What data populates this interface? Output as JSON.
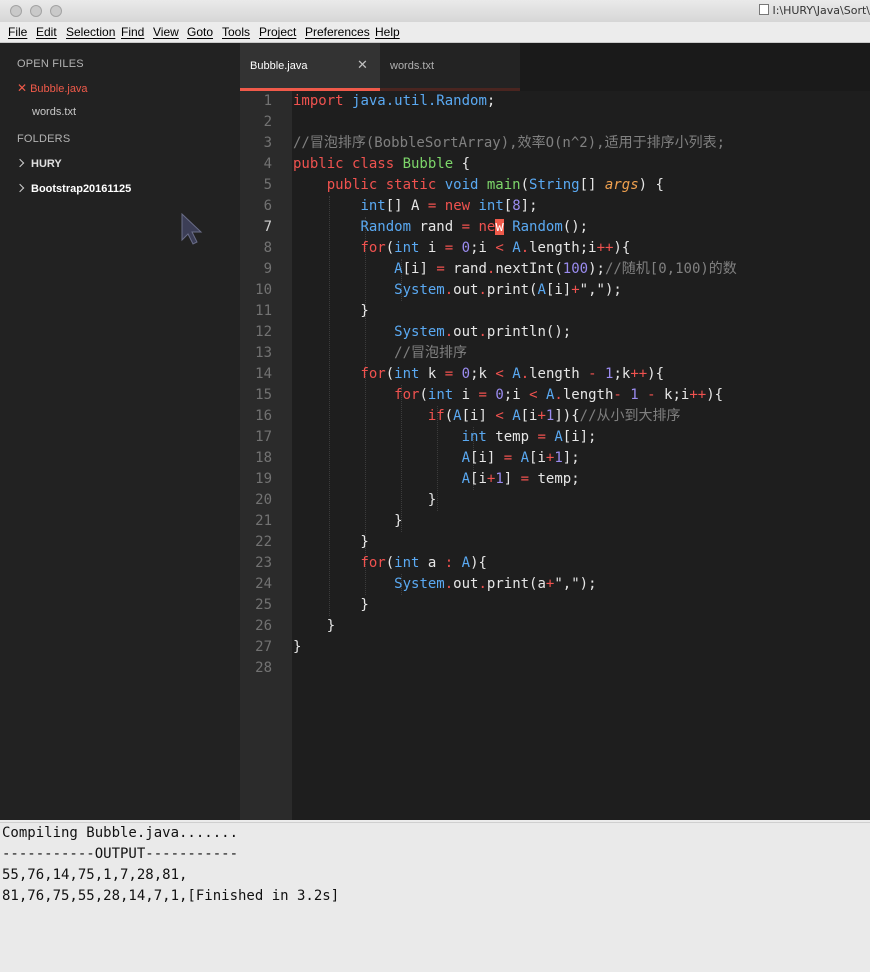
{
  "window": {
    "path": "I:\\HURY\\Java\\Sort\\"
  },
  "menu": [
    "File",
    "Edit",
    "Selection",
    "Find",
    "View",
    "Goto",
    "Tools",
    "Project",
    "Preferences",
    "Help"
  ],
  "sidebar": {
    "open_files_label": "OPEN FILES",
    "open_files": [
      "Bubble.java",
      "words.txt"
    ],
    "folders_label": "FOLDERS",
    "folders": [
      "HURY",
      "Bootstrap20161125"
    ]
  },
  "tabs": [
    "Bubble.java",
    "words.txt"
  ],
  "line_numbers": [
    "1",
    "2",
    "3",
    "4",
    "5",
    "6",
    "7",
    "8",
    "9",
    "10",
    "11",
    "12",
    "13",
    "14",
    "15",
    "16",
    "17",
    "18",
    "19",
    "20",
    "21",
    "22",
    "23",
    "24",
    "25",
    "26",
    "27",
    "28"
  ],
  "code": [
    {
      "t": [
        {
          "s": "import ",
          "c": "kw"
        },
        {
          "s": "java.util.Random",
          "c": "ty"
        },
        {
          "s": ";",
          "c": ""
        }
      ]
    },
    {
      "t": []
    },
    {
      "t": [
        {
          "s": "//冒泡排序(BobbleSortArray),效率O(n^2),适用于排序小列表;",
          "c": "cm"
        }
      ]
    },
    {
      "t": [
        {
          "s": "public class ",
          "c": "kw"
        },
        {
          "s": "Bubble",
          "c": "fn"
        },
        {
          "s": " {",
          "c": ""
        }
      ]
    },
    {
      "t": [
        {
          "s": "    public static ",
          "c": "kw"
        },
        {
          "s": "void ",
          "c": "ty"
        },
        {
          "s": "main",
          "c": "fn"
        },
        {
          "s": "(",
          "c": ""
        },
        {
          "s": "String",
          "c": "ty"
        },
        {
          "s": "[] ",
          "c": ""
        },
        {
          "s": "args",
          "c": "pr"
        },
        {
          "s": ") {",
          "c": ""
        }
      ]
    },
    {
      "t": [
        {
          "s": "        ",
          "c": ""
        },
        {
          "s": "int",
          "c": "ty"
        },
        {
          "s": "[] A ",
          "c": ""
        },
        {
          "s": "=",
          "c": "kw"
        },
        {
          "s": " ",
          "c": ""
        },
        {
          "s": "new ",
          "c": "kw"
        },
        {
          "s": "int",
          "c": "ty"
        },
        {
          "s": "[",
          "c": ""
        },
        {
          "s": "8",
          "c": "num"
        },
        {
          "s": "];",
          "c": ""
        }
      ]
    },
    {
      "t": [
        {
          "s": "        ",
          "c": ""
        },
        {
          "s": "Random",
          "c": "ty"
        },
        {
          "s": " rand ",
          "c": ""
        },
        {
          "s": "=",
          "c": "kw"
        },
        {
          "s": " ",
          "c": ""
        },
        {
          "s": "ne",
          "c": "kw"
        },
        {
          "s": "w",
          "c": "cursor"
        },
        {
          "s": " ",
          "c": ""
        },
        {
          "s": "Random",
          "c": "ty"
        },
        {
          "s": "();",
          "c": ""
        }
      ]
    },
    {
      "t": [
        {
          "s": "        ",
          "c": ""
        },
        {
          "s": "for",
          "c": "kw"
        },
        {
          "s": "(",
          "c": ""
        },
        {
          "s": "int",
          "c": "ty"
        },
        {
          "s": " i ",
          "c": ""
        },
        {
          "s": "=",
          "c": "kw"
        },
        {
          "s": " ",
          "c": ""
        },
        {
          "s": "0",
          "c": "num"
        },
        {
          "s": ";i ",
          "c": ""
        },
        {
          "s": "<",
          "c": "kw"
        },
        {
          "s": " ",
          "c": ""
        },
        {
          "s": "A",
          "c": "ty"
        },
        {
          "s": ".",
          "c": "kw"
        },
        {
          "s": "length;i",
          "c": ""
        },
        {
          "s": "++",
          "c": "kw"
        },
        {
          "s": "){",
          "c": ""
        }
      ]
    },
    {
      "t": [
        {
          "s": "            ",
          "c": ""
        },
        {
          "s": "A",
          "c": "ty"
        },
        {
          "s": "[i] ",
          "c": ""
        },
        {
          "s": "=",
          "c": "kw"
        },
        {
          "s": " rand",
          "c": ""
        },
        {
          "s": ".",
          "c": "kw"
        },
        {
          "s": "nextInt(",
          "c": ""
        },
        {
          "s": "100",
          "c": "num"
        },
        {
          "s": ");",
          "c": ""
        },
        {
          "s": "//随机[0,100)的数",
          "c": "cm"
        }
      ]
    },
    {
      "t": [
        {
          "s": "            ",
          "c": ""
        },
        {
          "s": "System",
          "c": "ty"
        },
        {
          "s": ".",
          "c": "kw"
        },
        {
          "s": "out",
          "c": ""
        },
        {
          "s": ".",
          "c": "kw"
        },
        {
          "s": "print(",
          "c": ""
        },
        {
          "s": "A",
          "c": "ty"
        },
        {
          "s": "[i]",
          "c": ""
        },
        {
          "s": "+",
          "c": "kw"
        },
        {
          "s": "\",\"",
          "c": "str"
        },
        {
          "s": ");",
          "c": ""
        }
      ]
    },
    {
      "t": [
        {
          "s": "        }",
          "c": ""
        }
      ]
    },
    {
      "t": [
        {
          "s": "            ",
          "c": ""
        },
        {
          "s": "System",
          "c": "ty"
        },
        {
          "s": ".",
          "c": "kw"
        },
        {
          "s": "out",
          "c": ""
        },
        {
          "s": ".",
          "c": "kw"
        },
        {
          "s": "println();",
          "c": ""
        }
      ]
    },
    {
      "t": [
        {
          "s": "            ",
          "c": ""
        },
        {
          "s": "//冒泡排序",
          "c": "cm"
        }
      ]
    },
    {
      "t": [
        {
          "s": "        ",
          "c": ""
        },
        {
          "s": "for",
          "c": "kw"
        },
        {
          "s": "(",
          "c": ""
        },
        {
          "s": "int",
          "c": "ty"
        },
        {
          "s": " k ",
          "c": ""
        },
        {
          "s": "=",
          "c": "kw"
        },
        {
          "s": " ",
          "c": ""
        },
        {
          "s": "0",
          "c": "num"
        },
        {
          "s": ";k ",
          "c": ""
        },
        {
          "s": "<",
          "c": "kw"
        },
        {
          "s": " ",
          "c": ""
        },
        {
          "s": "A",
          "c": "ty"
        },
        {
          "s": ".",
          "c": "kw"
        },
        {
          "s": "length ",
          "c": ""
        },
        {
          "s": "-",
          "c": "kw"
        },
        {
          "s": " ",
          "c": ""
        },
        {
          "s": "1",
          "c": "num"
        },
        {
          "s": ";k",
          "c": ""
        },
        {
          "s": "++",
          "c": "kw"
        },
        {
          "s": "){",
          "c": ""
        }
      ]
    },
    {
      "t": [
        {
          "s": "            ",
          "c": ""
        },
        {
          "s": "for",
          "c": "kw"
        },
        {
          "s": "(",
          "c": ""
        },
        {
          "s": "int",
          "c": "ty"
        },
        {
          "s": " i ",
          "c": ""
        },
        {
          "s": "=",
          "c": "kw"
        },
        {
          "s": " ",
          "c": ""
        },
        {
          "s": "0",
          "c": "num"
        },
        {
          "s": ";i ",
          "c": ""
        },
        {
          "s": "<",
          "c": "kw"
        },
        {
          "s": " ",
          "c": ""
        },
        {
          "s": "A",
          "c": "ty"
        },
        {
          "s": ".",
          "c": "kw"
        },
        {
          "s": "length",
          "c": ""
        },
        {
          "s": "-",
          "c": "kw"
        },
        {
          "s": " ",
          "c": ""
        },
        {
          "s": "1",
          "c": "num"
        },
        {
          "s": " ",
          "c": ""
        },
        {
          "s": "-",
          "c": "kw"
        },
        {
          "s": " k;i",
          "c": ""
        },
        {
          "s": "++",
          "c": "kw"
        },
        {
          "s": "){",
          "c": ""
        }
      ]
    },
    {
      "t": [
        {
          "s": "                ",
          "c": ""
        },
        {
          "s": "if",
          "c": "kw"
        },
        {
          "s": "(",
          "c": ""
        },
        {
          "s": "A",
          "c": "ty"
        },
        {
          "s": "[i] ",
          "c": ""
        },
        {
          "s": "<",
          "c": "kw"
        },
        {
          "s": " ",
          "c": ""
        },
        {
          "s": "A",
          "c": "ty"
        },
        {
          "s": "[i",
          "c": ""
        },
        {
          "s": "+",
          "c": "kw"
        },
        {
          "s": "1",
          "c": "num"
        },
        {
          "s": "]){",
          "c": ""
        },
        {
          "s": "//从小到大排序",
          "c": "cm"
        }
      ]
    },
    {
      "t": [
        {
          "s": "                    ",
          "c": ""
        },
        {
          "s": "int",
          "c": "ty"
        },
        {
          "s": " temp ",
          "c": ""
        },
        {
          "s": "=",
          "c": "kw"
        },
        {
          "s": " ",
          "c": ""
        },
        {
          "s": "A",
          "c": "ty"
        },
        {
          "s": "[i];",
          "c": ""
        }
      ]
    },
    {
      "t": [
        {
          "s": "                    ",
          "c": ""
        },
        {
          "s": "A",
          "c": "ty"
        },
        {
          "s": "[i] ",
          "c": ""
        },
        {
          "s": "=",
          "c": "kw"
        },
        {
          "s": " ",
          "c": ""
        },
        {
          "s": "A",
          "c": "ty"
        },
        {
          "s": "[i",
          "c": ""
        },
        {
          "s": "+",
          "c": "kw"
        },
        {
          "s": "1",
          "c": "num"
        },
        {
          "s": "];",
          "c": ""
        }
      ]
    },
    {
      "t": [
        {
          "s": "                    ",
          "c": ""
        },
        {
          "s": "A",
          "c": "ty"
        },
        {
          "s": "[i",
          "c": ""
        },
        {
          "s": "+",
          "c": "kw"
        },
        {
          "s": "1",
          "c": "num"
        },
        {
          "s": "] ",
          "c": ""
        },
        {
          "s": "=",
          "c": "kw"
        },
        {
          "s": " temp;",
          "c": ""
        }
      ]
    },
    {
      "t": [
        {
          "s": "                }",
          "c": ""
        }
      ]
    },
    {
      "t": [
        {
          "s": "            }",
          "c": ""
        }
      ]
    },
    {
      "t": [
        {
          "s": "        }",
          "c": ""
        }
      ]
    },
    {
      "t": [
        {
          "s": "        ",
          "c": ""
        },
        {
          "s": "for",
          "c": "kw"
        },
        {
          "s": "(",
          "c": ""
        },
        {
          "s": "int",
          "c": "ty"
        },
        {
          "s": " a ",
          "c": ""
        },
        {
          "s": ":",
          "c": "kw"
        },
        {
          "s": " ",
          "c": ""
        },
        {
          "s": "A",
          "c": "ty"
        },
        {
          "s": "){",
          "c": ""
        }
      ]
    },
    {
      "t": [
        {
          "s": "            ",
          "c": ""
        },
        {
          "s": "System",
          "c": "ty"
        },
        {
          "s": ".",
          "c": "kw"
        },
        {
          "s": "out",
          "c": ""
        },
        {
          "s": ".",
          "c": "kw"
        },
        {
          "s": "print(a",
          "c": ""
        },
        {
          "s": "+",
          "c": "kw"
        },
        {
          "s": "\",\"",
          "c": "str"
        },
        {
          "s": ");",
          "c": ""
        }
      ]
    },
    {
      "t": [
        {
          "s": "        }",
          "c": ""
        }
      ]
    },
    {
      "t": [
        {
          "s": "    }",
          "c": ""
        }
      ]
    },
    {
      "t": [
        {
          "s": "}",
          "c": ""
        }
      ]
    },
    {
      "t": []
    }
  ],
  "output": [
    "Compiling Bubble.java.......",
    "-----------OUTPUT-----------",
    "55,76,14,75,1,7,28,81,",
    "81,76,75,55,28,14,7,1,[Finished in 3.2s]"
  ]
}
